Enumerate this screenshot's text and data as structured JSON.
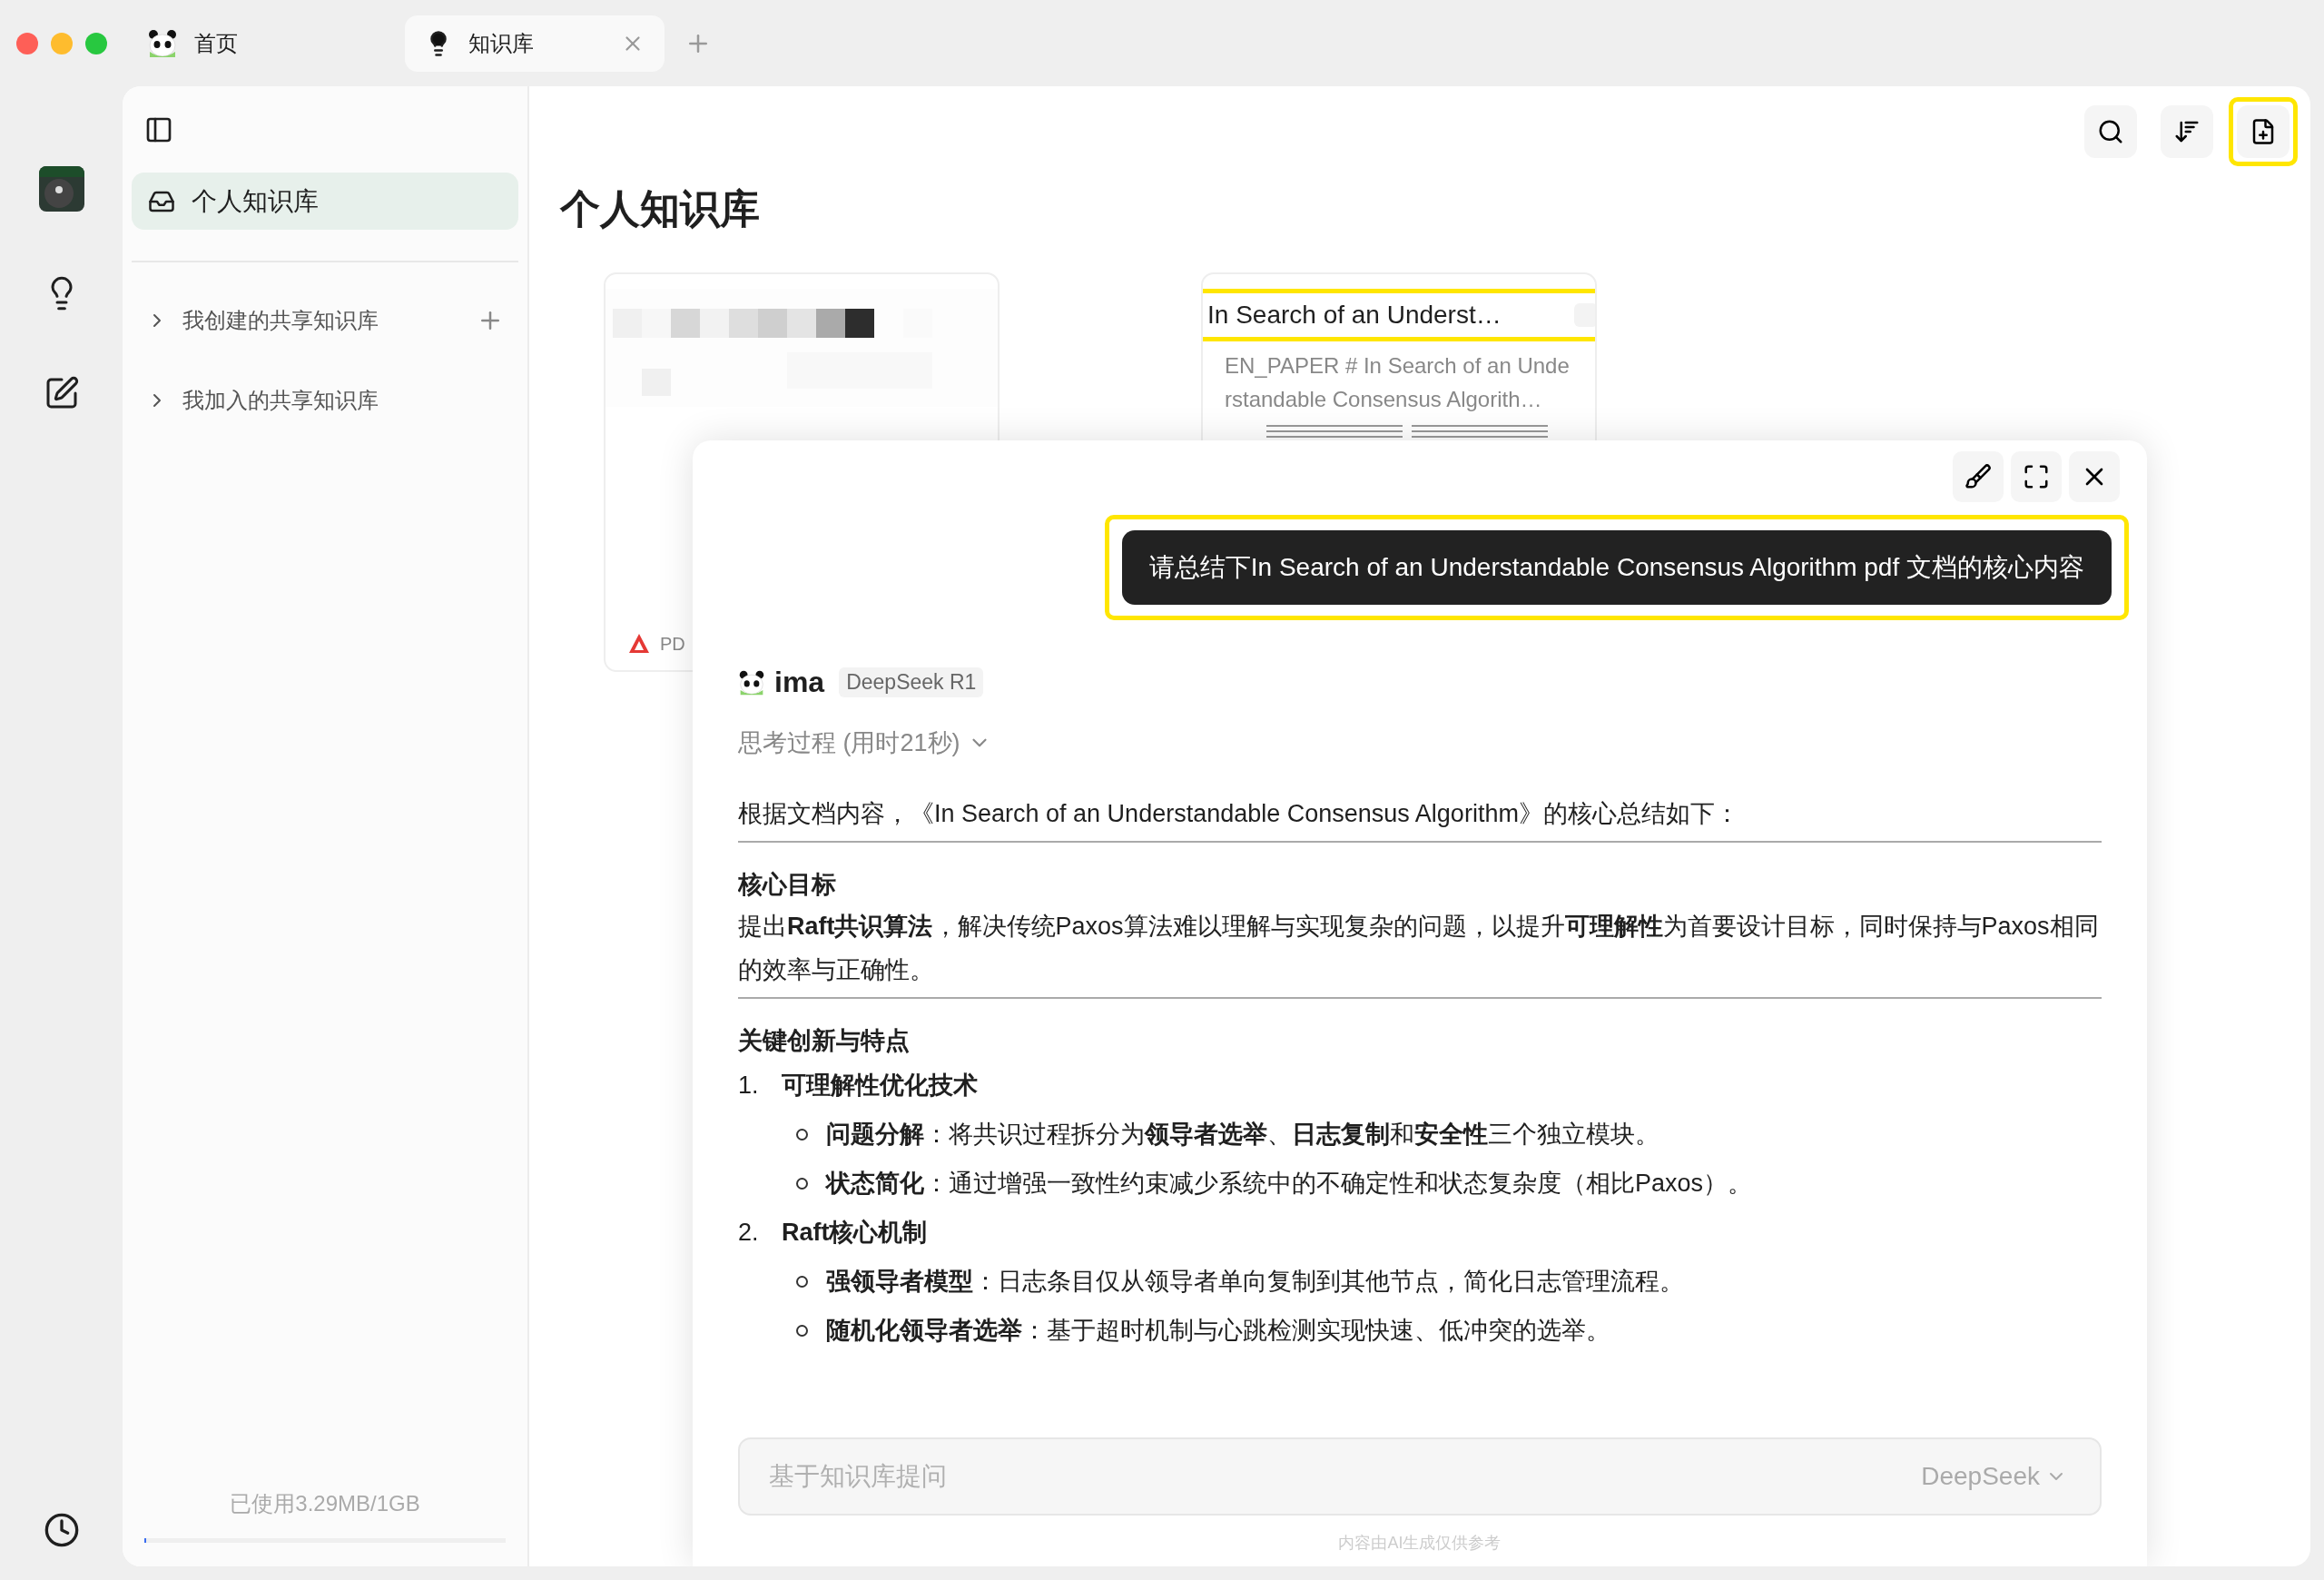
{
  "tabs": [
    {
      "label": "首页",
      "selected": false,
      "closable": false
    },
    {
      "label": "知识库",
      "selected": true,
      "closable": true
    }
  ],
  "sidebar": {
    "items": [
      {
        "label": "个人知识库",
        "selected": true
      }
    ],
    "groups": [
      {
        "label": "我创建的共享知识库",
        "expanded": false,
        "addable": true
      },
      {
        "label": "我加入的共享知识库",
        "expanded": false,
        "addable": false
      }
    ],
    "usage": {
      "text": "已使用3.29MB/1GB",
      "level": 0.003
    }
  },
  "main": {
    "title": "个人知识库",
    "toolbar": [
      {
        "kind": "search",
        "highlighted": false
      },
      {
        "kind": "sort",
        "highlighted": false
      },
      {
        "kind": "new",
        "highlighted": true
      }
    ],
    "cards": [
      {
        "kind": "blurred",
        "footer": "PD"
      },
      {
        "kind": "doc",
        "title": "In Search of an Underst…",
        "excerpt": "EN_PAPER # In Search of an Understandable Consensus Algorith…",
        "highlighted": true
      }
    ]
  },
  "chat": {
    "question": {
      "text": "请总结下In Search of an Understandable Consensus Algorithm pdf 文档的核心内容",
      "highlighted": true
    },
    "assistant": {
      "name": "ima",
      "model": "DeepSeek R1"
    },
    "thinking": {
      "label": "思考过程 (用时21秒)",
      "expanded": false
    },
    "blocks": [
      {
        "kind": "paragraph",
        "text": "根据文档内容，《In Search of an Understandable Consensus Algorithm》的核心总结如下：",
        "rule": true
      },
      {
        "kind": "heading",
        "text": "核心目标"
      },
      {
        "kind": "paragraph",
        "text": "提出**Raft共识算法**，解决传统Paxos算法难以理解与实现复杂的问题，以提升**可理解性**为首要设计目标，同时保持与Paxos相同的效率与正确性。",
        "rule": true
      },
      {
        "kind": "heading",
        "text": "关键创新与特点"
      },
      {
        "kind": "numbered",
        "number": "1.",
        "text": "可理解性优化技术",
        "items": [
          "**问题分解**：将共识过程拆分为**领导者选举**、**日志复制**和**安全性**三个独立模块。",
          "**状态简化**：通过增强一致性约束减少系统中的不确定性和状态复杂度（相比Paxos）。"
        ]
      },
      {
        "kind": "numbered",
        "number": "2.",
        "text": "Raft核心机制",
        "items": [
          "**强领导者模型**：日志条目仅从领导者单向复制到其他节点，简化日志管理流程。",
          "**随机化领导者选举**：基于超时机制与心跳检测实现快速、低冲突的选举。"
        ]
      }
    ],
    "input": {
      "placeholder": "基于知识库提问",
      "model": "DeepSeek"
    },
    "disclaimer": "内容由AI生成仅供参考"
  }
}
